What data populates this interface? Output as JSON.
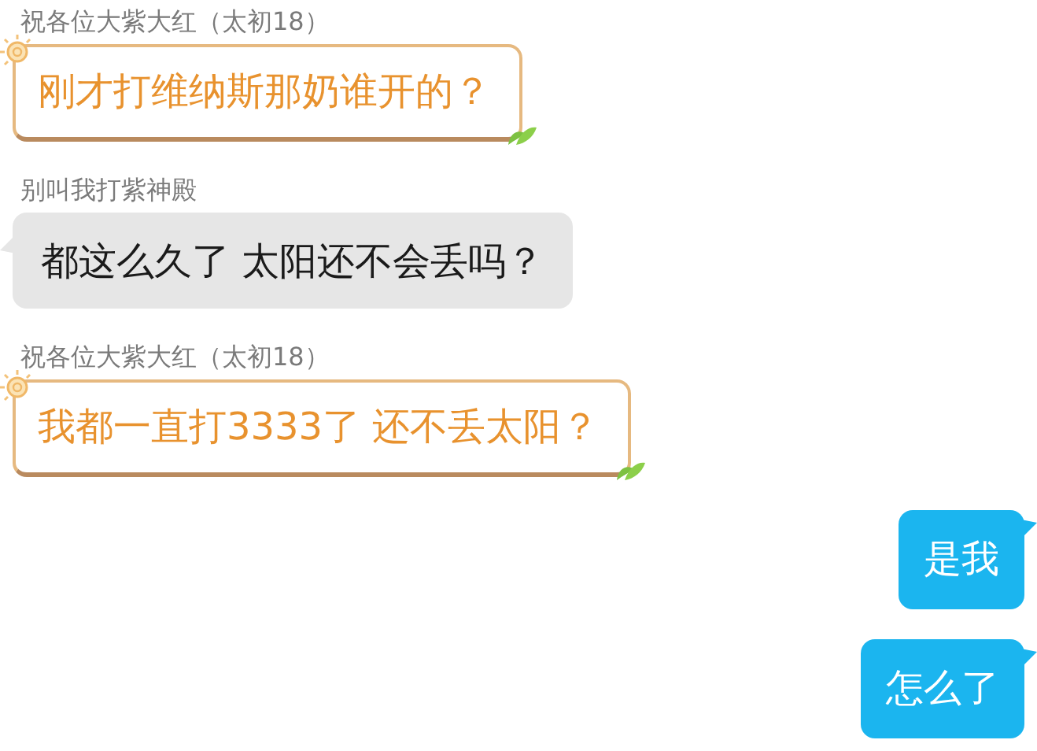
{
  "messages": [
    {
      "kind": "themed",
      "sender": "祝各位大紫大红（太初18）",
      "text": "刚才打维纳斯那奶谁开的？"
    },
    {
      "kind": "plain",
      "sender": "别叫我打紫神殿",
      "text": "都这么久了  太阳还不会丢吗？"
    },
    {
      "kind": "themed",
      "sender": "祝各位大紫大红（太初18）",
      "text": "我都一直打3333了  还不丢太阳？"
    },
    {
      "kind": "self",
      "text": "是我"
    },
    {
      "kind": "self",
      "text": "怎么了"
    }
  ]
}
